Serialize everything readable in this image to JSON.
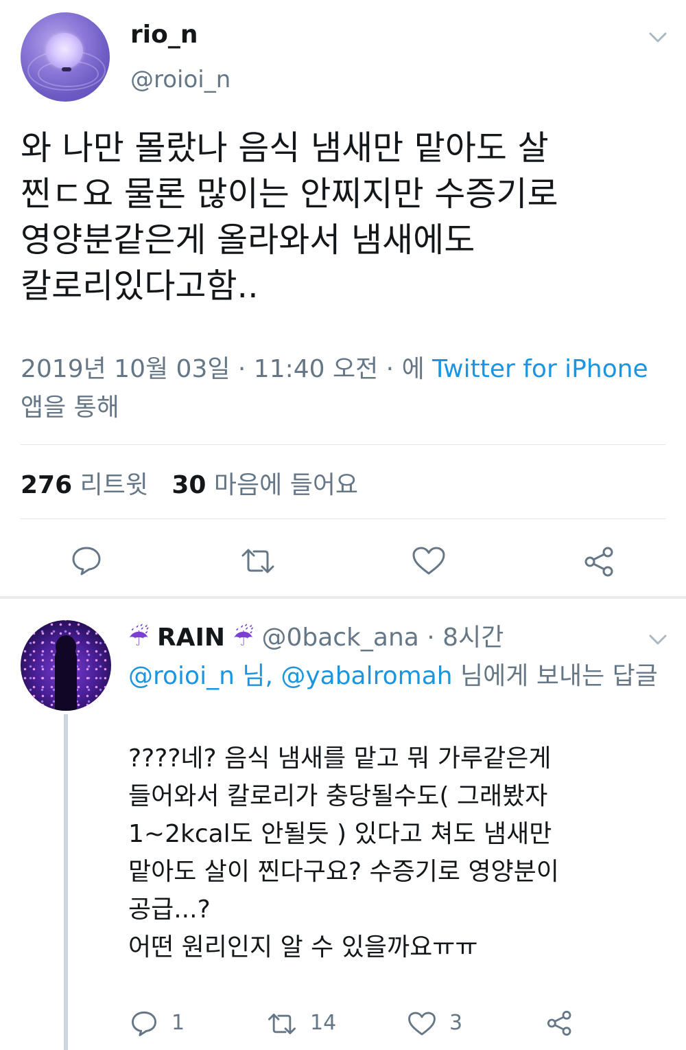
{
  "main_tweet": {
    "display_name": "rio_n",
    "handle": "@roioi_n",
    "text": "와 나만 몰랐나 음식 냄새만 맡아도 살\n찐ㄷ요 물론 많이는 안찌지만 수증기로\n영양분같은게 올라와서 냄새에도\n칼로리있다고함..",
    "meta_date": "2019년 10월 03일 · 11:40 오전 · 에 ",
    "meta_source": "Twitter for iPhone",
    "meta_suffix": " 앱을 통해",
    "retweets_count": "276",
    "retweets_label": "리트윗",
    "likes_count": "30",
    "likes_label": "마음에 들어요",
    "icons": [
      "reply-icon",
      "retweet-icon",
      "like-icon",
      "share-icon"
    ]
  },
  "reply_tweet": {
    "emoji_left": "☔",
    "display_name": "RAIN",
    "emoji_right": "☔",
    "handle": "@0back_ana",
    "time": " · 8시간",
    "reply_to_mention1": "@roioi_n 님, ",
    "reply_to_mention2": "@yabalromah",
    "reply_to_suffix": " 님에게 보내는 답글",
    "text": "????네? 음식 냄새를 맡고 뭐 가루같은게\n들어와서 칼로리가 충당될수도( 그래봤자\n1~2kcal도 안될듯 ) 있다고 쳐도 냄새만\n맡아도 살이 찐다구요? 수증기로 영양분이\n공급...?\n어떤 원리인지 알 수 있을까요ㅠㅠ",
    "reply_count": "1",
    "retweet_count": "14",
    "like_count": "3"
  },
  "colors": {
    "text": "#14171a",
    "secondary": "#657786",
    "link": "#1b95e0",
    "divider": "#e1e8ed"
  }
}
